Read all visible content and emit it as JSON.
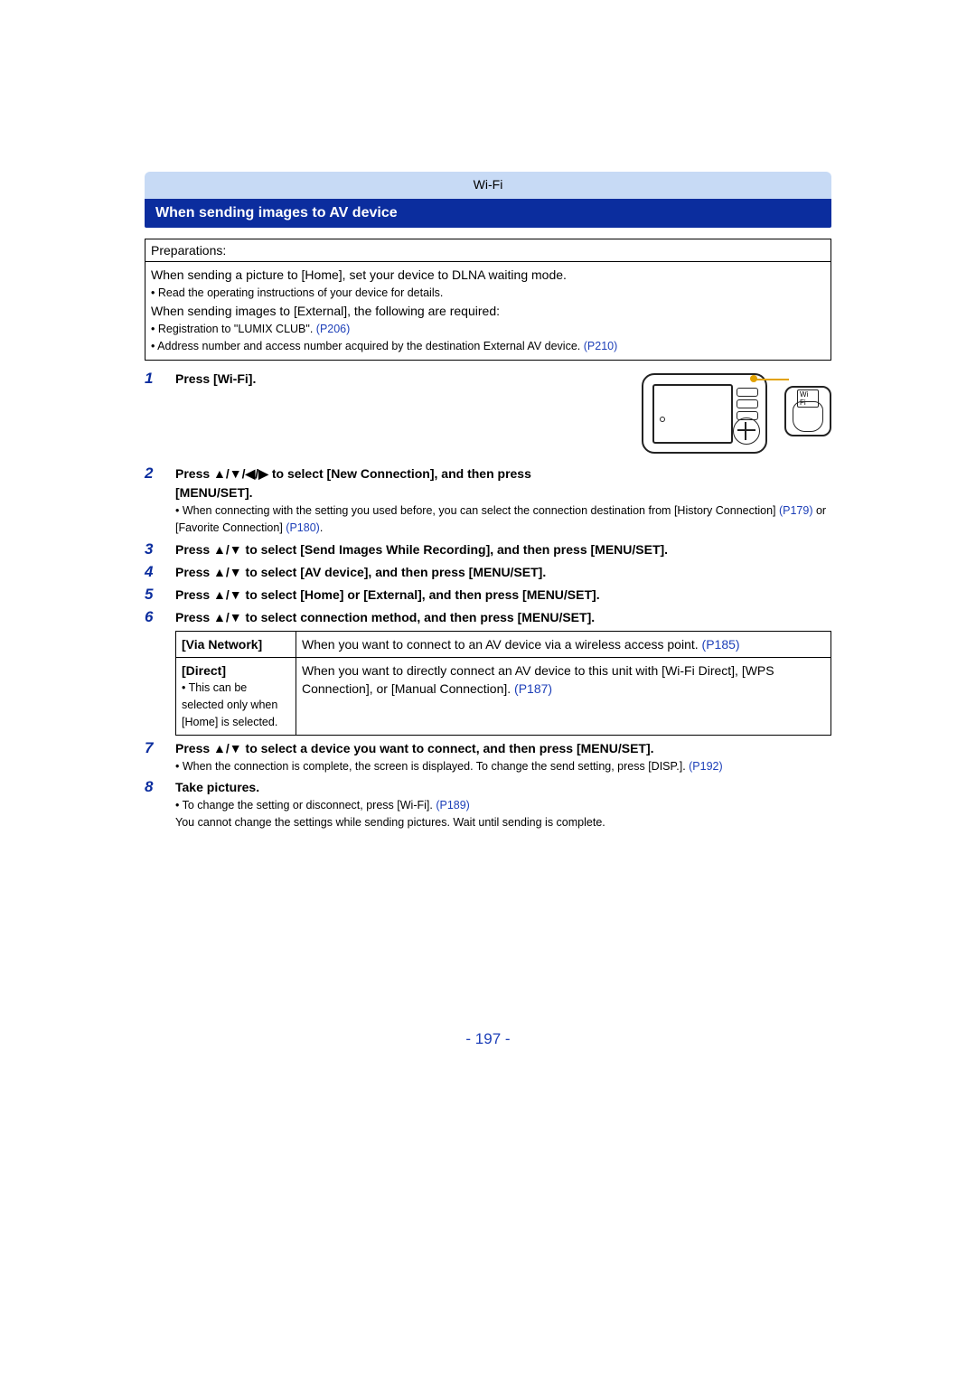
{
  "header": {
    "category": "Wi-Fi"
  },
  "section": {
    "title": "When sending images to AV device"
  },
  "prep": {
    "label": "Preparations:",
    "line1": "When sending a picture to [Home], set your device to DLNA waiting mode.",
    "line2": "Read the operating instructions of your device for details.",
    "line3": "When sending images to [External], the following are required:",
    "line4a": "Registration to \"LUMIX CLUB\". ",
    "line4link": "(P206)",
    "line5a": "Address number and access number acquired by the destination External AV device. ",
    "line5link": "(P210)"
  },
  "steps": {
    "s1": {
      "num": "1",
      "text": "Press [Wi-Fi]."
    },
    "s2": {
      "num": "2",
      "line1": "Press ▲/▼/◀/▶ to select [New Connection], and then press [MENU/SET].",
      "bullet_a": "When connecting with the setting you used before, you can select the connection destination from [History Connection] ",
      "bullet_link1": "(P179)",
      "bullet_b": " or [Favorite Connection] ",
      "bullet_link2": "(P180)",
      "bullet_c": "."
    },
    "s3": {
      "num": "3",
      "text": "Press ▲/▼ to select [Send Images While Recording], and then press [MENU/SET]."
    },
    "s4": {
      "num": "4",
      "text": "Press ▲/▼ to select [AV device], and then press [MENU/SET]."
    },
    "s5": {
      "num": "5",
      "text": "Press ▲/▼ to select [Home] or [External], and then press [MENU/SET]."
    },
    "s6": {
      "num": "6",
      "text": "Press ▲/▼ to select connection method, and then press [MENU/SET]."
    },
    "s7": {
      "num": "7",
      "text": "Press ▲/▼ to select a device you want to connect, and then press [MENU/SET].",
      "bullet": "When the connection is complete, the screen is displayed. To change the send setting, press [DISP.]. ",
      "bullet_link": "(P192)"
    },
    "s8": {
      "num": "8",
      "text": "Take pictures.",
      "bullet_a": "To change the setting or disconnect, press [Wi-Fi]. ",
      "bullet_link": "(P189)",
      "bullet_b": "You cannot change the settings while sending pictures. Wait until sending is complete."
    }
  },
  "table": {
    "row1": {
      "label": "[Via Network]",
      "desc": "When you want to connect to an AV device via a wireless access point. ",
      "link": "(P185)"
    },
    "row2": {
      "label": "[Direct]",
      "sub": "This can be selected only when [Home] is selected.",
      "desc": "When you want to directly connect an AV device to this unit with [Wi-Fi Direct], [WPS Connection], or [Manual Connection]. ",
      "link": "(P187)"
    }
  },
  "figure": {
    "wifi_label": "Wi Fi"
  },
  "page": {
    "number": "- 197 -"
  }
}
